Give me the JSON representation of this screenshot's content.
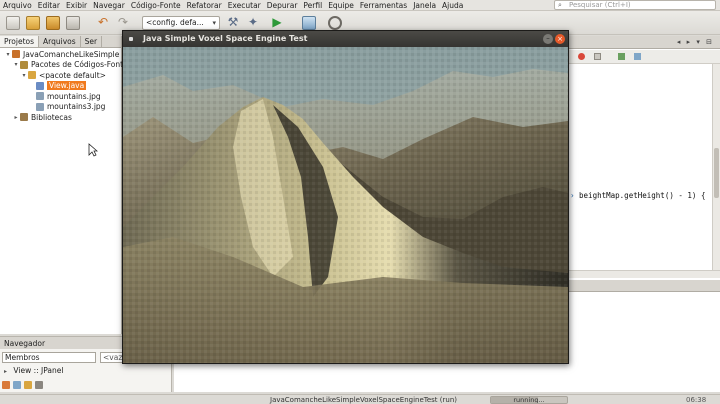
{
  "menubar": {
    "items": [
      "Arquivo",
      "Editar",
      "Exibir",
      "Navegar",
      "Código-Fonte",
      "Refatorar",
      "Executar",
      "Depurar",
      "Perfil",
      "Equipe",
      "Ferramentas",
      "Janela",
      "Ajuda"
    ],
    "search_placeholder": "Pesquisar (Ctrl+I)"
  },
  "toolbar": {
    "config_value": "<config. defa...",
    "icons": [
      "new-file-icon",
      "new-project-icon",
      "open-project-icon",
      "save-all-icon",
      "undo-icon",
      "redo-icon",
      "build-icon",
      "clean-build-icon",
      "run-icon",
      "debug-icon",
      "profile-icon"
    ]
  },
  "projects": {
    "tabs": [
      "Projetos",
      "Arquivos",
      "Ser"
    ],
    "tree": [
      {
        "label": "JavaComancheLikeSimple",
        "indent": 0,
        "arrow": "▾",
        "color": "#c8712a"
      },
      {
        "label": "Pacotes de Códigos-Font",
        "indent": 1,
        "arrow": "▾",
        "color": "#b08c3c"
      },
      {
        "label": "<pacote default>",
        "indent": 2,
        "arrow": "▾",
        "color": "#d9a640"
      },
      {
        "label": "View.java",
        "indent": 3,
        "arrow": "",
        "color": "#6a8cc4",
        "selected": true
      },
      {
        "label": "mountains.jpg",
        "indent": 3,
        "arrow": "",
        "color": "#8aa0b6"
      },
      {
        "label": "mountains3.jpg",
        "indent": 3,
        "arrow": "",
        "color": "#8aa0b6"
      },
      {
        "label": "Bibliotecas",
        "indent": 1,
        "arrow": "▸",
        "color": "#9a7a4a"
      }
    ]
  },
  "navigator": {
    "title": "Navegador",
    "members_value": "Membros",
    "filter_value": "<vazi",
    "node_label": "View :: JPanel"
  },
  "editor": {
    "code_line": "beightMap.getHeight() - 1) {"
  },
  "statusbar": {
    "title": "JavaComancheLikeSimpleVoxelSpaceEngineTest (run)",
    "progress_label": "running...",
    "progress": 0.62,
    "time": "06:38"
  },
  "app_window": {
    "title": "Java Simple Voxel Space Engine Test",
    "min_glyph": "–",
    "close_glyph": "×"
  },
  "colors": {
    "selection": "#f07a1e",
    "close_button": "#e65a2a",
    "sky": "#8fa3a4"
  }
}
